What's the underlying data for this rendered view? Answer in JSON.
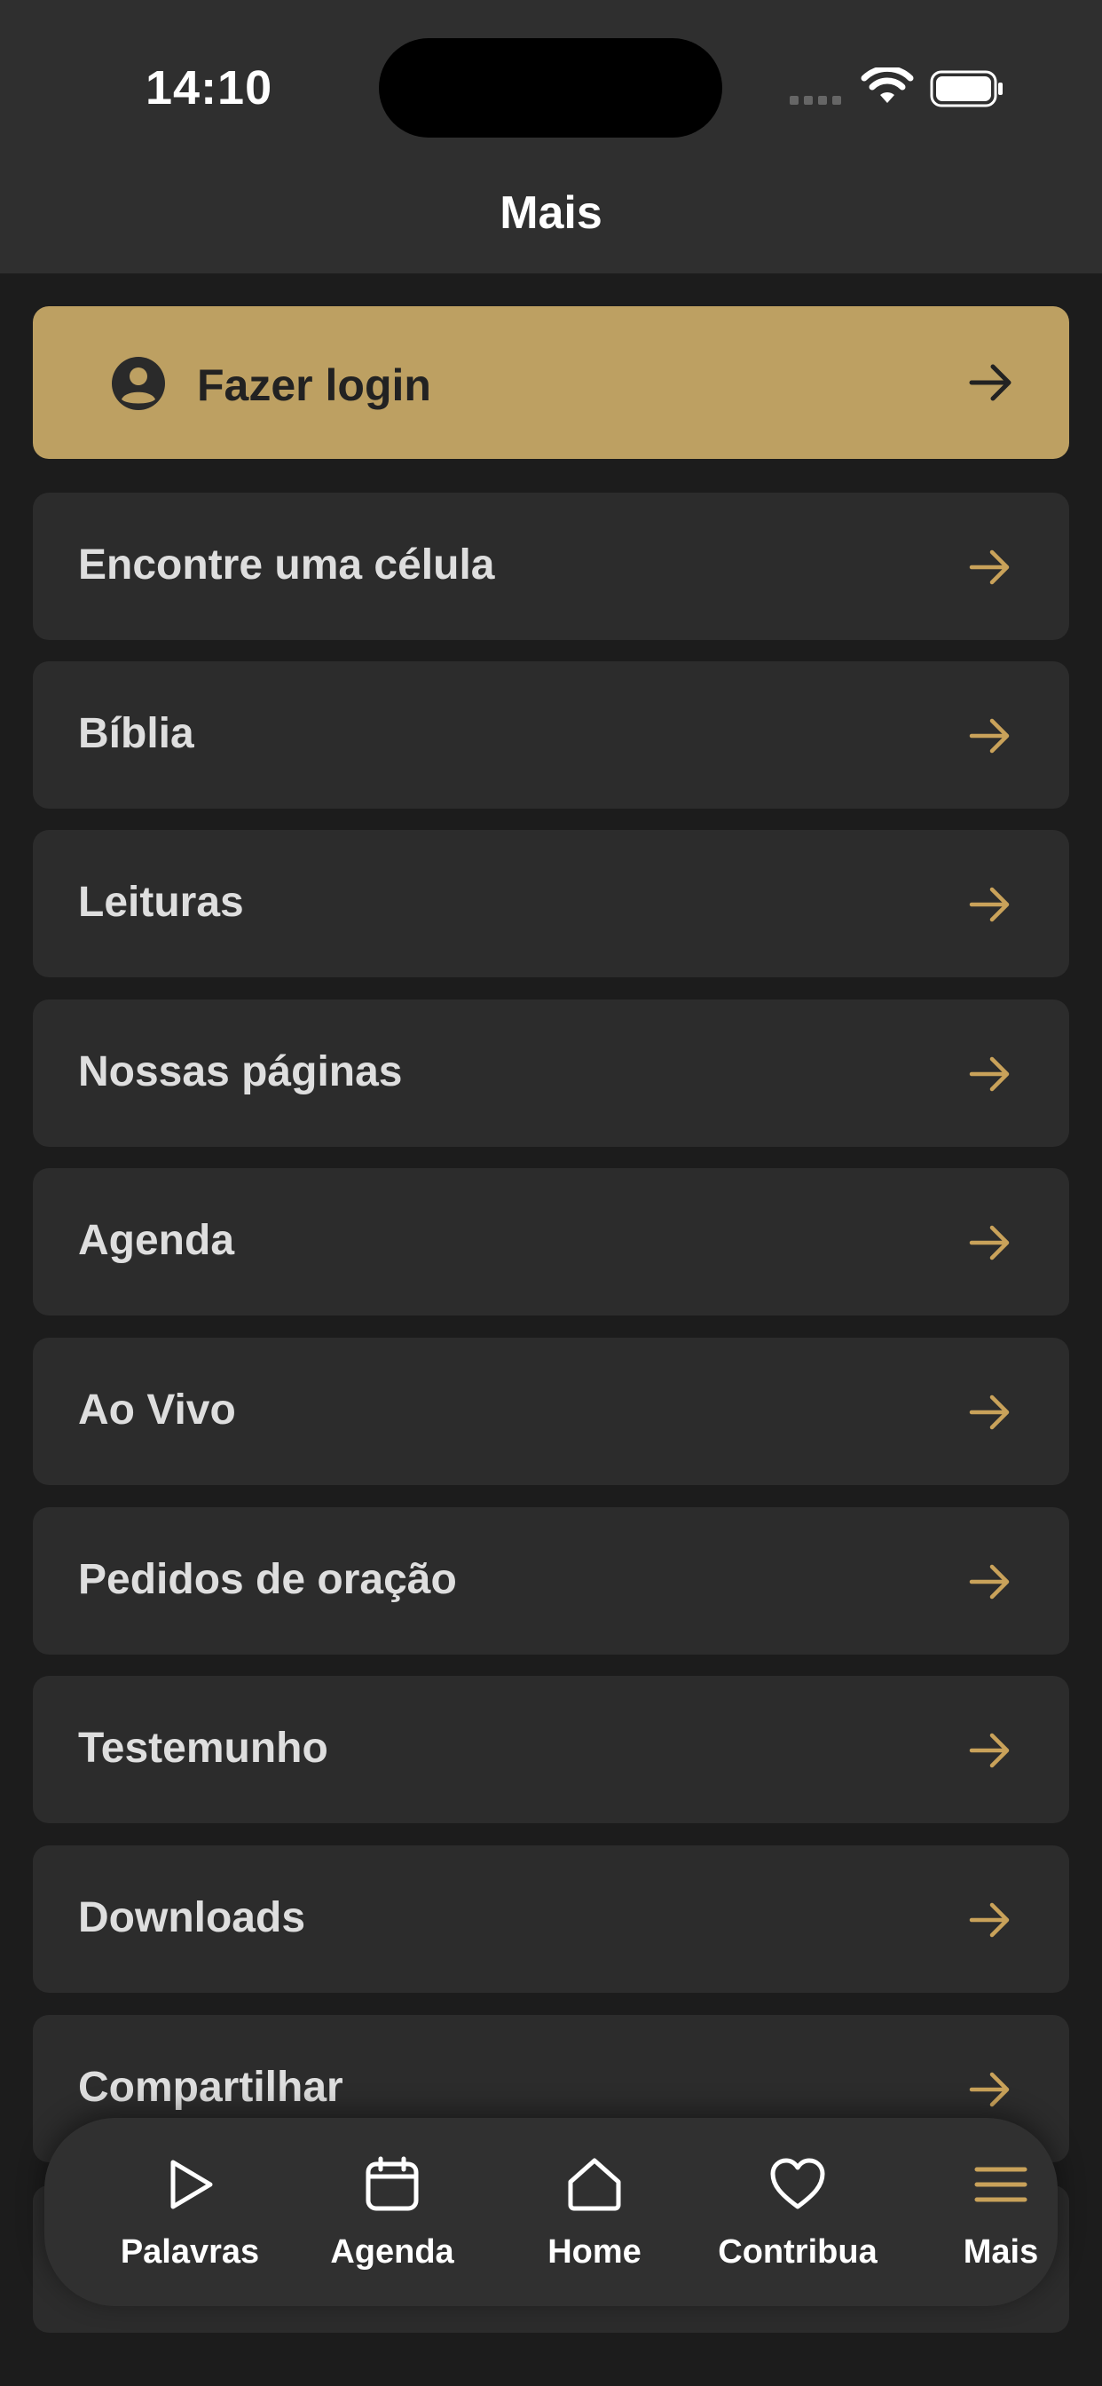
{
  "status_bar": {
    "time": "14:10"
  },
  "header": {
    "title": "Mais"
  },
  "login": {
    "label": "Fazer login"
  },
  "menu": [
    {
      "label": "Encontre uma célula"
    },
    {
      "label": "Bíblia"
    },
    {
      "label": "Leituras"
    },
    {
      "label": "Nossas páginas"
    },
    {
      "label": "Agenda"
    },
    {
      "label": "Ao Vivo"
    },
    {
      "label": "Pedidos de oração"
    },
    {
      "label": "Testemunho"
    },
    {
      "label": "Downloads"
    },
    {
      "label": "Compartilhar"
    }
  ],
  "tabbar": {
    "tabs": [
      {
        "label": "Palavras",
        "icon": "play-icon"
      },
      {
        "label": "Agenda",
        "icon": "calendar-icon"
      },
      {
        "label": "Home",
        "icon": "home-icon"
      },
      {
        "label": "Contribua",
        "icon": "heart-icon"
      },
      {
        "label": "Mais",
        "icon": "menu-icon",
        "active": true
      }
    ]
  },
  "colors": {
    "background": "#1c1c1c",
    "header": "#2f2f2f",
    "card": "#2c2c2c",
    "accent": "#bda062",
    "arrow": "#c9a25a"
  }
}
